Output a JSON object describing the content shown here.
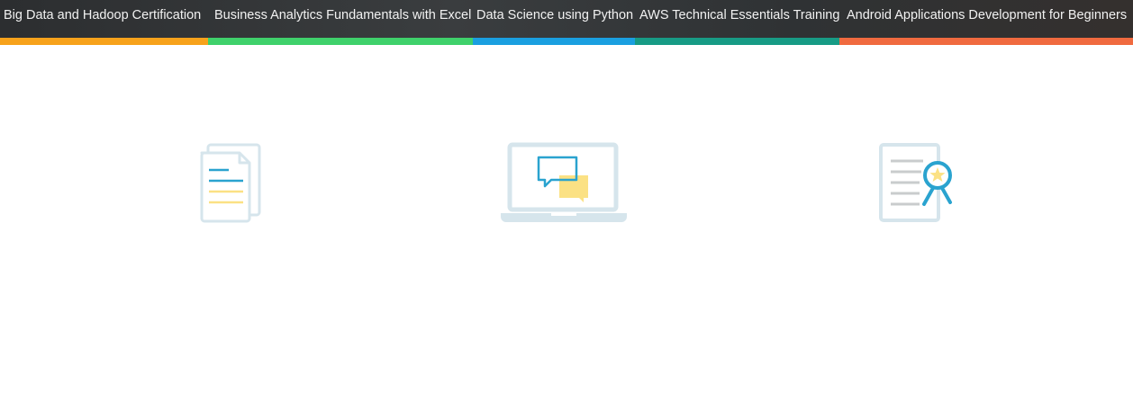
{
  "course_nav": {
    "tabs": [
      {
        "label": "Big Data and Hadoop Certification",
        "color": "#f7a21b"
      },
      {
        "label": "Business Analytics Fundamentals with Excel",
        "color": "#3fd16b"
      },
      {
        "label": "Data Science using Python",
        "color": "#1a9fe0"
      },
      {
        "label": "AWS Technical Essentials Training",
        "color": "#179b85"
      },
      {
        "label": "Android Applications Development for Beginners",
        "color": "#f06a3f"
      }
    ]
  },
  "features": {
    "icons": [
      "documents-icon",
      "laptop-chat-icon",
      "certificate-icon"
    ],
    "colors": {
      "outline": "#d6e5ec",
      "accent_blue": "#2aa3cf",
      "accent_yellow": "#fbe184",
      "gray_lines": "#c9cccd"
    }
  }
}
